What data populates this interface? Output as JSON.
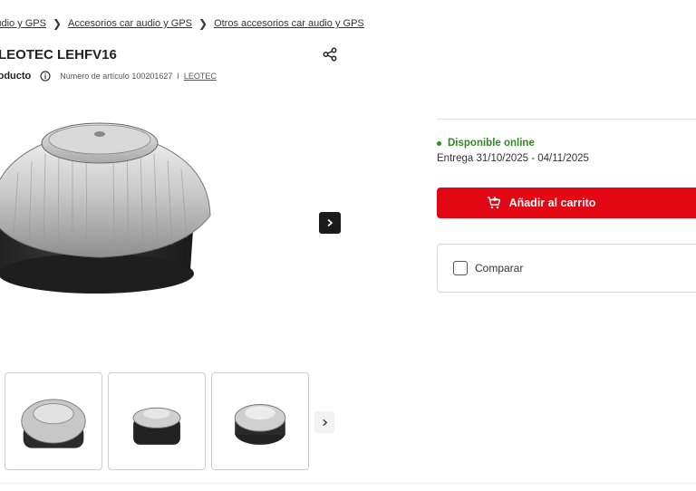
{
  "breadcrumb": {
    "items": [
      "Audio y GPS",
      "Accesorios car audio y GPS",
      "Otros accesorios car audio y GPS"
    ]
  },
  "product": {
    "title": "LEOTEC LEHFV16",
    "label": "Producto",
    "article_number": "Número de artículo 100201627",
    "separator": "I",
    "brand": "LEOTEC"
  },
  "availability": {
    "status": "Disponible online",
    "delivery": "Entrega 31/10/2025 - 04/11/2025"
  },
  "actions": {
    "add_to_cart": "Añadir al carrito",
    "compare": "Comparar"
  },
  "colors": {
    "brand_red": "#e30613",
    "available_green": "#2e8b22"
  },
  "icons": {
    "share": "share-icon",
    "info": "info-icon",
    "cart": "cart-icon",
    "next": "chevron-right-icon"
  }
}
